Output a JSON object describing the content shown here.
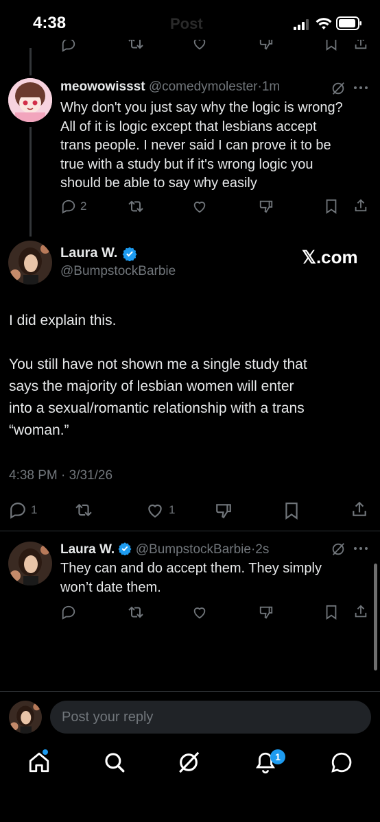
{
  "status_bar": {
    "time": "4:38",
    "header_title": "Post"
  },
  "reply1": {
    "display_name": "meowowissst",
    "handle": "@comedymolester",
    "sep": "·",
    "time": "1m",
    "text_lines": [
      "Why don't you just say why the logic is wrong?",
      "All of it is logic except that lesbians accept",
      "trans people. I never said I can prove it to be",
      "true with a study but if it's wrong logic you",
      "should be able to say why easily"
    ],
    "reply_count": "2"
  },
  "main_post": {
    "display_name": "Laura W.",
    "handle": "@BumpstockBarbie",
    "watermark": "𝕏.com",
    "para1": "I did explain this.",
    "para2_lines": [
      "You still have not shown me a single study that",
      "says the majority of lesbian women will enter",
      "into a sexual/romantic relationship with a trans",
      "“woman.”"
    ],
    "timestamp": "4:38 PM · 3/31/26",
    "reply_count": "1",
    "like_count": "1"
  },
  "reply2": {
    "display_name": "Laura W.",
    "handle": "@BumpstockBarbie",
    "sep": "·",
    "time": "2s",
    "text_lines": [
      "They can and do accept them. They simply",
      "won’t date them."
    ]
  },
  "composer": {
    "placeholder": "Post your reply"
  },
  "tab_bar": {
    "notification_badge": "1"
  },
  "colors": {
    "accent": "#1d9bf0",
    "muted": "#71767b",
    "text": "#e7e9ea"
  }
}
